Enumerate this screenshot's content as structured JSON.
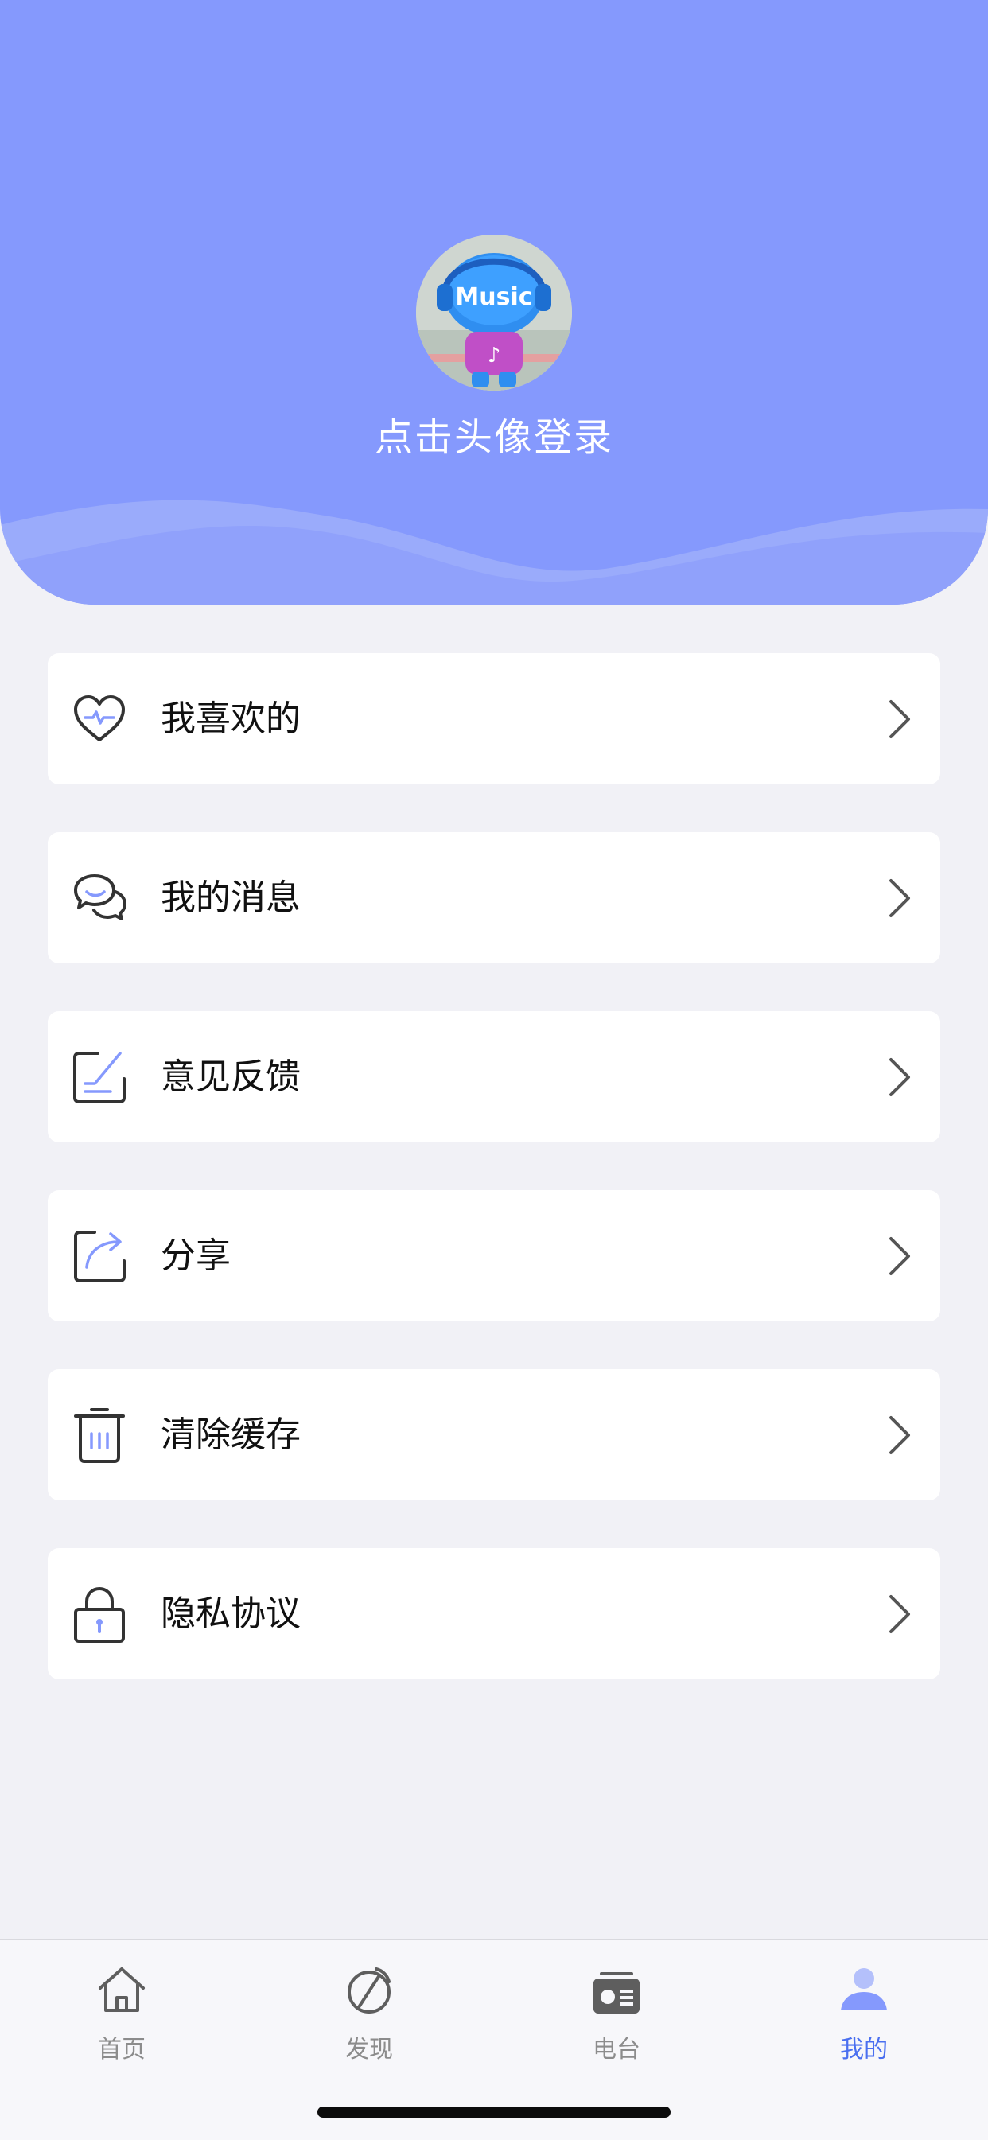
{
  "header": {
    "login_prompt": "点击头像登录",
    "avatar_text": "Music",
    "background_color": "#8599fd"
  },
  "menu": {
    "items": [
      {
        "label": "我喜欢的",
        "icon": "heart-pulse-icon"
      },
      {
        "label": "我的消息",
        "icon": "chat-bubbles-icon"
      },
      {
        "label": "意见反馈",
        "icon": "feedback-pencil-icon"
      },
      {
        "label": "分享",
        "icon": "share-arrow-icon"
      },
      {
        "label": "清除缓存",
        "icon": "trash-icon"
      },
      {
        "label": "隐私协议",
        "icon": "lock-icon"
      }
    ],
    "chevron_icon": "chevron-right-icon"
  },
  "tabbar": {
    "active_color": "#4a6ff0",
    "items": [
      {
        "label": "首页",
        "icon": "home-icon",
        "active": false
      },
      {
        "label": "发现",
        "icon": "discover-icon",
        "active": false
      },
      {
        "label": "电台",
        "icon": "radio-icon",
        "active": false
      },
      {
        "label": "我的",
        "icon": "person-icon",
        "active": true
      }
    ]
  }
}
